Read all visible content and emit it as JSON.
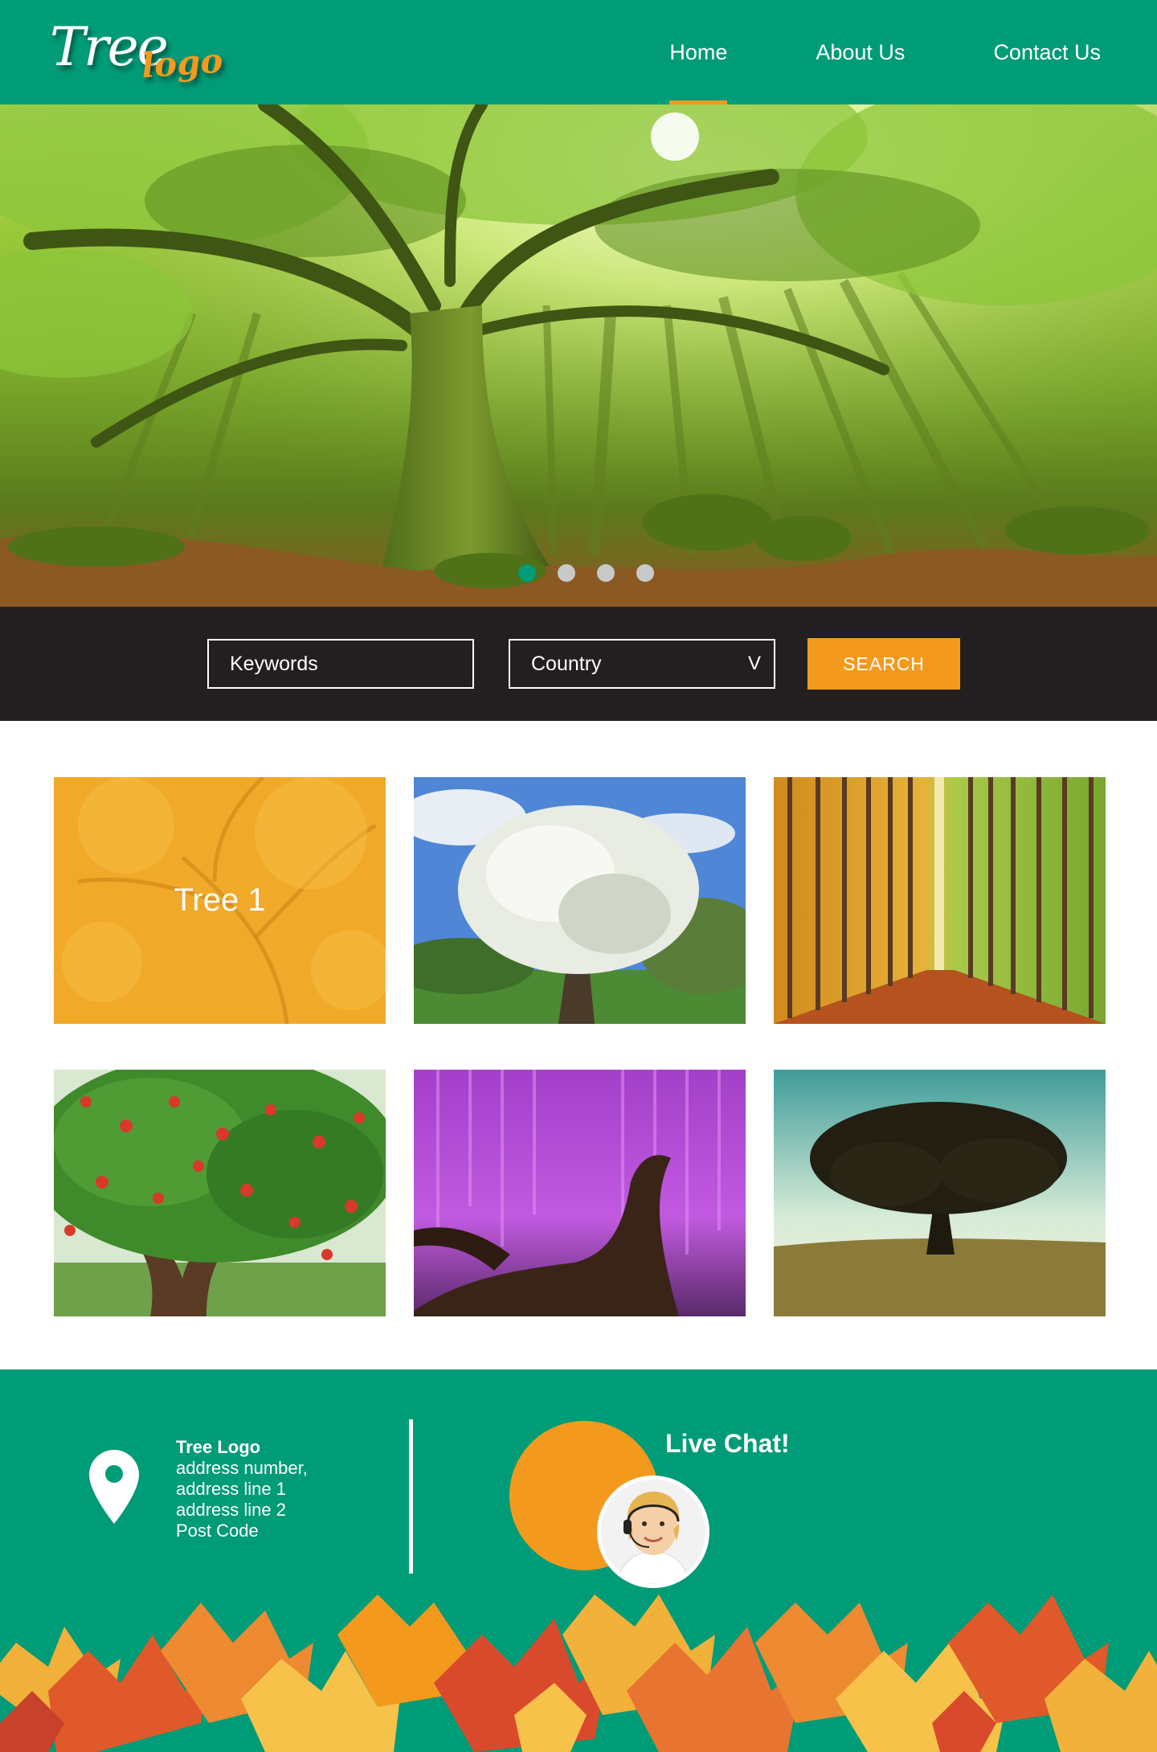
{
  "header": {
    "logo_text_main": "Tree",
    "logo_text_sub": "logo",
    "nav": [
      {
        "label": "Home",
        "active": true
      },
      {
        "label": "About Us",
        "active": false
      },
      {
        "label": "Contact Us",
        "active": false
      }
    ]
  },
  "hero": {
    "slide_count": 4,
    "active_slide": 1
  },
  "search": {
    "keywords_placeholder": "Keywords",
    "country_value": "Country",
    "country_chevron": "V",
    "button_label": "SEARCH"
  },
  "gallery": {
    "tiles": [
      {
        "caption": "Tree 1",
        "image": "autumn-tree-orange-overlay"
      },
      {
        "caption": "",
        "image": "white-blossom-tree"
      },
      {
        "caption": "",
        "image": "poplar-avenue"
      },
      {
        "caption": "",
        "image": "apple-tree"
      },
      {
        "caption": "",
        "image": "purple-wisteria"
      },
      {
        "caption": "",
        "image": "lone-tree-silhouette"
      }
    ]
  },
  "footer": {
    "address_title": "Tree Logo",
    "address_lines": [
      "address number,",
      "address line 1",
      "address line 2",
      "Post Code"
    ],
    "chat_title": "Live Chat!"
  },
  "colors": {
    "brand_green": "#009b77",
    "accent_orange": "#f39a1e",
    "search_bar_bg": "#231f20"
  }
}
